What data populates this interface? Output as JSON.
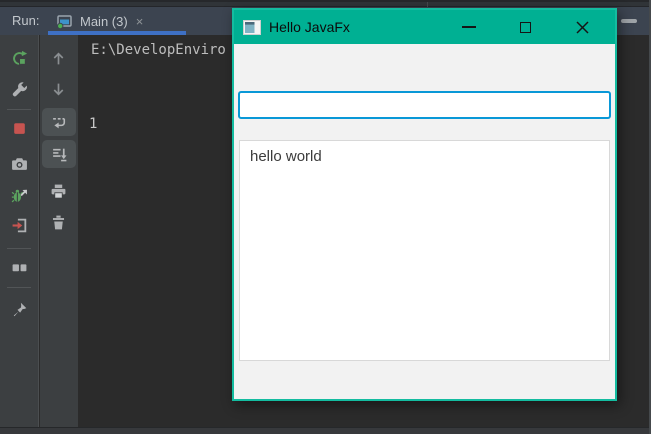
{
  "ide": {
    "header": {
      "run_label": "Run:",
      "tab": {
        "label": "Main (3)",
        "close_glyph": "×"
      },
      "hide_button_icon": "minimize-dash-icon"
    },
    "left_toolbar_icons": [
      "rerun-icon",
      "wrench-icon",
      "stop-icon",
      "camera-icon",
      "restart-debug-icon",
      "exit-icon",
      "layout-icon",
      "pin-icon"
    ],
    "console_toolbar_icons": [
      "up-arrow-icon",
      "down-arrow-icon",
      "soft-wrap-icon",
      "scroll-to-end-icon",
      "printer-icon",
      "trash-icon"
    ],
    "console": {
      "line1": "E:\\DevelopEnviro",
      "line2": "1"
    }
  },
  "app_window": {
    "title": "Hello JavaFx",
    "titlebar_icons": [
      "app-icon",
      "minimize-icon",
      "maximize-icon",
      "close-icon"
    ],
    "text_field": {
      "value": ""
    },
    "text_area": {
      "value": "hello world"
    }
  },
  "colors": {
    "titlebar_teal": "#00B093",
    "window_border_teal": "#14BCA0",
    "focus_border_blue": "#0998D7",
    "tab_underline_blue": "#3E70C4",
    "header_bg": "#3C4450",
    "console_bg": "#2B2B2B",
    "toolbar_bg": "#3C3F41",
    "stop_red": "#C75450",
    "run_green": "#5BA35F"
  }
}
